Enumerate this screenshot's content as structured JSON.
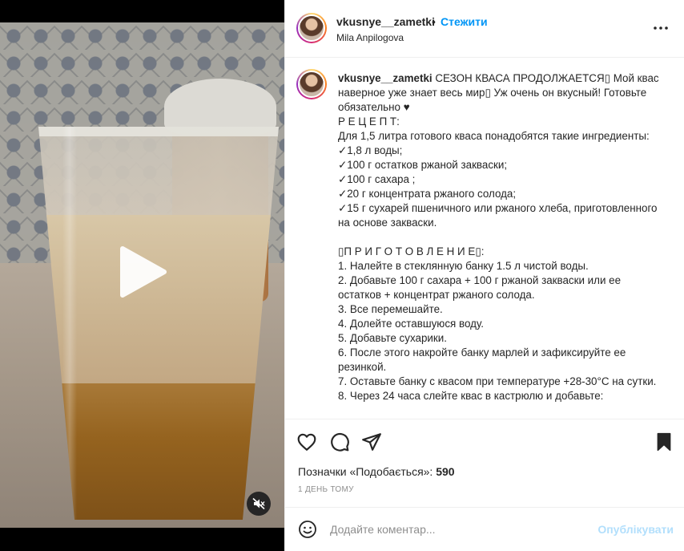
{
  "post": {
    "username": "vkusnye__zametki",
    "separator": "•",
    "follow_label": "Стежити",
    "subtitle": "Mila Anpilogova",
    "caption_lines": [
      "СЕЗОН КВАСА ПРОДОЛЖАЕТСЯ▯ Мой квас наверное уже знает весь мир▯ Уж очень он вкусный! Готовьте обязательно ♥",
      "Р Е Ц Е П Т:",
      "Для 1,5 литра готового кваса понадобятся такие ингредиенты:",
      "✓1,8 л воды;",
      "✓100 г остатков ржаной закваски;",
      "✓100 г сахара ;",
      "✓20 г концентрата ржаного солода;",
      "✓15 г сухарей пшеничного или ржаного хлеба, приготовленного на основе закваски.",
      "",
      "▯П Р И Г О Т О В Л Е Н И Е▯:",
      "1. Налейте в стеклянную банку 1.5 л чистой воды.",
      "2. Добавьте 100 г сахара + 100 г ржаной закваски или ее остатков + концентрат ржаного солода.",
      "3. Все перемешайте.",
      "4. Долейте оставшуюся воду.",
      "5. Добавьте сухарики.",
      "6. После этого накройте банку марлей и зафиксируйте ее резинкой.",
      "7. Оставьте банку с квасом при температуре +28-30°С на сутки.",
      "8. Через 24 часа слейте квас в кастрюлю и добавьте:"
    ],
    "likes_prefix": "Позначки «Подобається»: ",
    "likes_count": "590",
    "time_ago": "1 ДЕНЬ ТОМУ"
  },
  "comment": {
    "placeholder": "Додайте коментар...",
    "publish_label": "Опублікувати"
  },
  "icons": {
    "play": "play-icon",
    "mute": "mute-icon",
    "more": "more-options-icon",
    "like": "heart-icon",
    "comment": "comment-icon",
    "share": "share-icon",
    "save": "bookmark-icon",
    "emoji": "emoji-icon"
  },
  "colors": {
    "accent": "#0095f6",
    "publish_disabled": "#b2dffc",
    "muted_text": "#8e8e8e"
  }
}
